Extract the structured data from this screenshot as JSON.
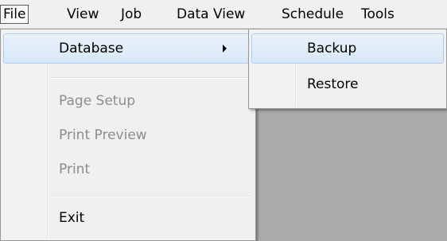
{
  "menubar": {
    "items": [
      "File",
      "View",
      "Job",
      "Data View",
      "Schedule",
      "Tools"
    ]
  },
  "file_menu": {
    "database": "Database",
    "page_setup": "Page Setup",
    "print_preview": "Print Preview",
    "print": "Print",
    "exit": "Exit"
  },
  "database_submenu": {
    "backup": "Backup",
    "restore": "Restore"
  },
  "colors": {
    "highlight": "#d9e8f7",
    "disabled_text": "#8d8d8d",
    "workspace": "#ababab"
  },
  "icons": {
    "submenu_arrow": "chevron-right-icon"
  }
}
